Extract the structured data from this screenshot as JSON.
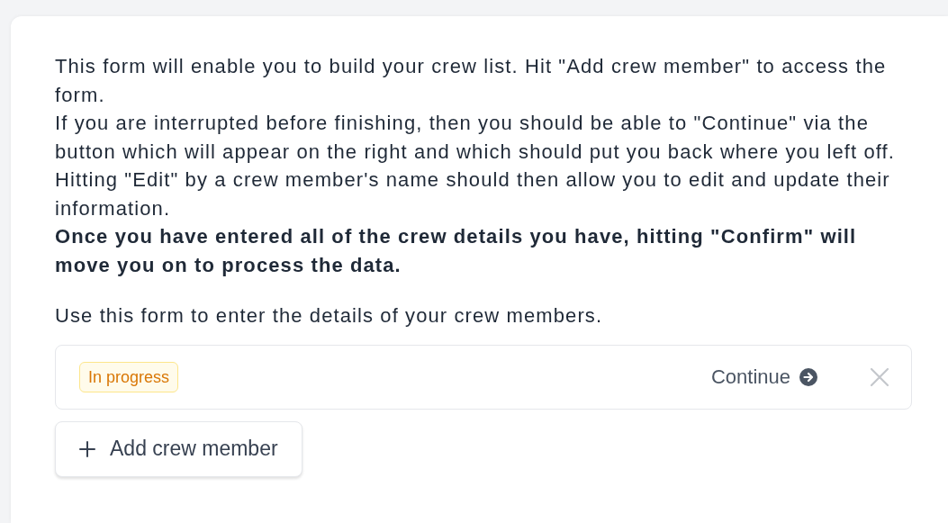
{
  "intro": [
    "This form will enable you to build your crew list. Hit \"Add crew member\" to access the form.",
    "If you are interrupted before finishing, then you should be able to \"Continue\" via the button which will appear on the right and which should put you back where you left off.",
    "Hitting \"Edit\" by a crew member's name should then allow you to edit and update their information."
  ],
  "notice": "Once you have entered all of the crew details you have, hitting \"Confirm\" will move you on to process the data.",
  "instruction": "Use this form to enter the details of your crew members.",
  "entries": [
    {
      "status": "In progress",
      "action": "Continue"
    }
  ],
  "add_button": {
    "label": "Add crew member"
  }
}
